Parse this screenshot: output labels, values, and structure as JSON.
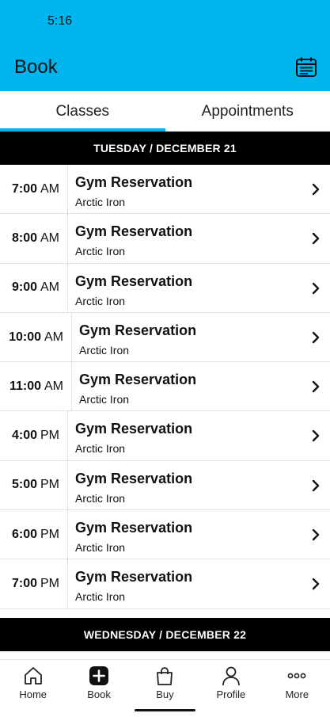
{
  "status": {
    "time": "5:16"
  },
  "appbar": {
    "title": "Book",
    "calendar_icon": "calendar-icon"
  },
  "colors": {
    "accent": "#00b4ee",
    "header_bg": "#000000"
  },
  "tabs": [
    {
      "label": "Classes",
      "active": true
    },
    {
      "label": "Appointments",
      "active": false
    }
  ],
  "days": [
    {
      "label": "TUESDAY / DECEMBER 21"
    },
    {
      "label": "WEDNESDAY / DECEMBER 22"
    }
  ],
  "classes": [
    {
      "time": "7:00",
      "ampm": "AM",
      "title": "Gym Reservation",
      "location": "Arctic Iron"
    },
    {
      "time": "8:00",
      "ampm": "AM",
      "title": "Gym Reservation",
      "location": "Arctic Iron"
    },
    {
      "time": "9:00",
      "ampm": "AM",
      "title": "Gym Reservation",
      "location": "Arctic Iron"
    },
    {
      "time": "10:00",
      "ampm": "AM",
      "title": "Gym Reservation",
      "location": "Arctic Iron"
    },
    {
      "time": "11:00",
      "ampm": "AM",
      "title": "Gym Reservation",
      "location": "Arctic Iron"
    },
    {
      "time": "4:00",
      "ampm": "PM",
      "title": "Gym Reservation",
      "location": "Arctic Iron"
    },
    {
      "time": "5:00",
      "ampm": "PM",
      "title": "Gym Reservation",
      "location": "Arctic Iron"
    },
    {
      "time": "6:00",
      "ampm": "PM",
      "title": "Gym Reservation",
      "location": "Arctic Iron"
    },
    {
      "time": "7:00",
      "ampm": "PM",
      "title": "Gym Reservation",
      "location": "Arctic Iron"
    }
  ],
  "nav": [
    {
      "label": "Home",
      "icon": "home-icon"
    },
    {
      "label": "Book",
      "icon": "plus-icon"
    },
    {
      "label": "Buy",
      "icon": "shopping-bag-icon"
    },
    {
      "label": "Profile",
      "icon": "person-icon"
    },
    {
      "label": "More",
      "icon": "more-dots-icon"
    }
  ]
}
